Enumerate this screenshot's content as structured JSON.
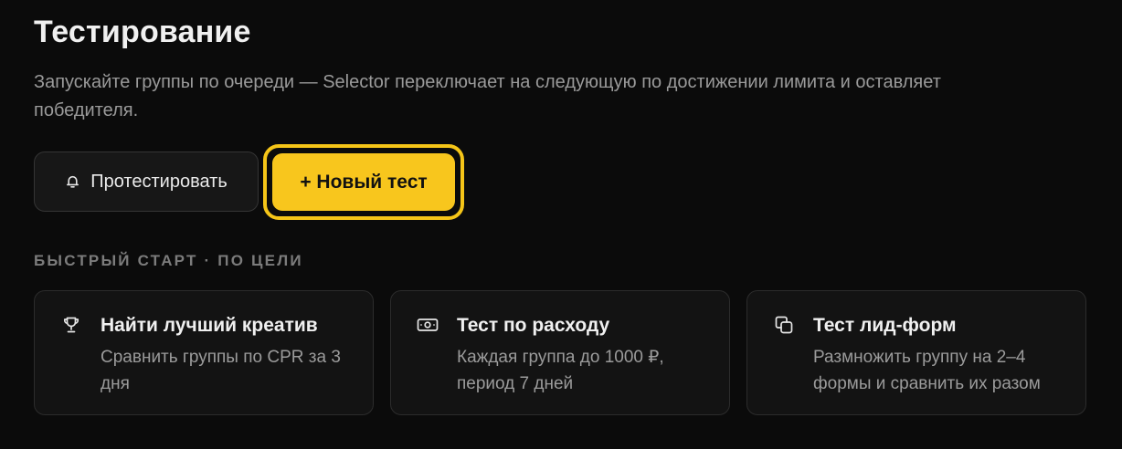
{
  "page": {
    "title": "Тестирование",
    "subtitle": "Запускайте группы по очереди — Selector переключает на следующую по достижении лимита и оставляет победителя."
  },
  "actions": {
    "test_button_label": "Протестировать",
    "test_button_icon": "bell-icon",
    "new_test_label": "+ Новый тест",
    "accent_color": "#f8c61d"
  },
  "quick_start": {
    "label": "БЫСТРЫЙ СТАРТ · ПО ЦЕЛИ",
    "cards": [
      {
        "icon": "trophy-icon",
        "title": "Найти лучший креатив",
        "description": "Сравнить группы по CPR за 3 дня"
      },
      {
        "icon": "banknote-icon",
        "title": "Тест по расходу",
        "description": "Каждая группа до 1000 ₽, период 7 дней"
      },
      {
        "icon": "copy-icon",
        "title": "Тест лид-форм",
        "description": "Размножить группу на 2–4 формы и сравнить их разом"
      }
    ]
  }
}
